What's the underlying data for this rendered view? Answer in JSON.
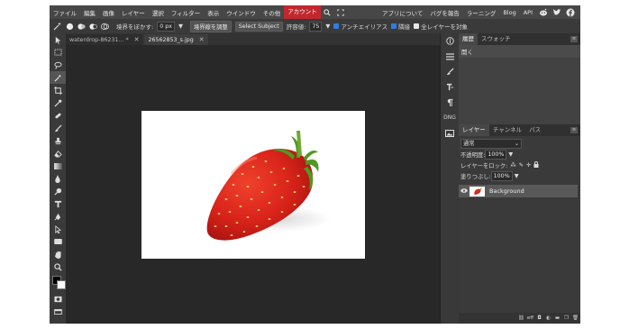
{
  "menubar": {
    "items": [
      "ファイル",
      "編集",
      "画像",
      "レイヤー",
      "選択",
      "フィルター",
      "表示",
      "ウインドウ",
      "その他"
    ],
    "account": "アカウント",
    "right_links": [
      "アプリについて",
      "バグを報告",
      "ラーニング",
      "Blog",
      "API"
    ],
    "accent_color": "#c0282e"
  },
  "options": {
    "feather_label": "境界をぼかす:",
    "feather_value": "0 px",
    "refine_edge": "境界線を調整",
    "select_subject": "Select Subject",
    "tolerance_label": "許容値:",
    "tolerance_value": "75",
    "antialias": "アンチエイリアス",
    "contiguous": "隣接",
    "all_layers": "全レイヤーを対象"
  },
  "documents": {
    "tabs": [
      {
        "title": "waterdrop-86231...",
        "modified": "*"
      },
      {
        "title": "26562853_s.jpg",
        "modified": ""
      }
    ]
  },
  "panels": {
    "history_tab": "履歴",
    "swatches_tab": "スウォッチ",
    "history_items": [
      "開く"
    ],
    "layers_tab": "レイヤー",
    "channels_tab": "チャンネル",
    "paths_tab": "パス",
    "blend_mode": "通常",
    "opacity_label": "不透明度:",
    "opacity_value": "100%",
    "lock_label": "レイヤーをロック:",
    "fill_label": "塗りつぶし:",
    "fill_value": "100%",
    "layer_name": "Background"
  },
  "side_strip": {
    "dng_label": "DNG"
  }
}
